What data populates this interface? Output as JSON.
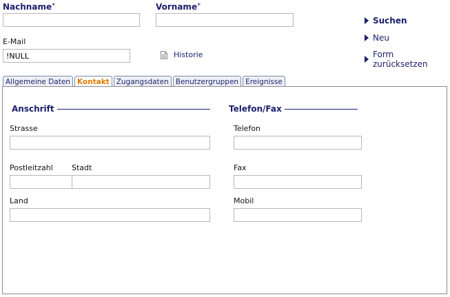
{
  "header": {
    "nachname_label": "Nachname",
    "vorname_label": "Vorname",
    "required_mark": "*",
    "nachname_value": "",
    "vorname_value": "",
    "email_label": "E-Mail",
    "email_value": "!NULL",
    "historie_label": "Historie"
  },
  "actions": {
    "search": "Suchen",
    "new": "Neu",
    "reset": "Form zurücksetzen"
  },
  "tabs": [
    {
      "label": "Allgemeine Daten",
      "active": false
    },
    {
      "label": "Kontakt",
      "active": true
    },
    {
      "label": "Zugangsdaten",
      "active": false
    },
    {
      "label": "Benutzergruppen",
      "active": false
    },
    {
      "label": "Ereignisse",
      "active": false
    }
  ],
  "address": {
    "title": "Anschrift",
    "street_label": "Strasse",
    "street_value": "",
    "zip_label": "Postleitzahl",
    "zip_value": "",
    "city_label": "Stadt",
    "city_value": "",
    "country_label": "Land",
    "country_value": ""
  },
  "phone": {
    "title": "Telefon/Fax",
    "phone_label": "Telefon",
    "phone_value": "",
    "fax_label": "Fax",
    "fax_value": "",
    "mobile_label": "Mobil",
    "mobile_value": ""
  },
  "colors": {
    "accent": "#1b1f6b",
    "active_tab": "#e07a00",
    "border": "#b7b7b7"
  }
}
